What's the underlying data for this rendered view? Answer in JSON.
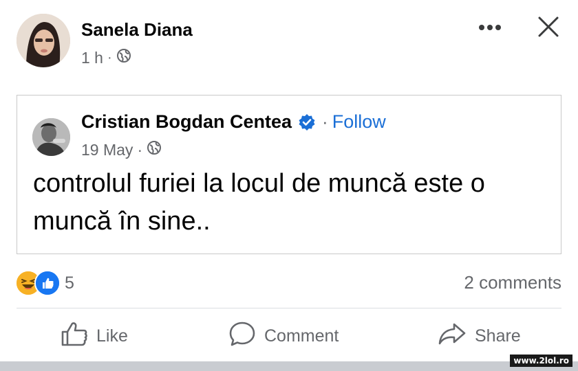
{
  "post": {
    "author": "Sanela Diana",
    "time": "1 h",
    "separator": "·",
    "privacy_icon": "globe-icon"
  },
  "shared_post": {
    "author": "Cristian Bogdan Centea",
    "verified_icon": "verified-badge-icon",
    "follow_separator": "·",
    "follow_label": "Follow",
    "date": "19 May",
    "separator": "·",
    "privacy_icon": "globe-icon",
    "text": "controlul furiei la locul de muncă este o muncă în sine.."
  },
  "engagement": {
    "reaction_icons": [
      "haha-reaction-icon",
      "like-reaction-icon"
    ],
    "reaction_count": "5",
    "comments": "2 comments"
  },
  "actions": {
    "like": "Like",
    "comment": "Comment",
    "share": "Share"
  },
  "watermark": "www.2lol.ro",
  "colors": {
    "accent": "#1b6fd6",
    "muted": "#65676b",
    "text": "#050505",
    "haha": "#f7b125",
    "like": "#1877f2"
  }
}
